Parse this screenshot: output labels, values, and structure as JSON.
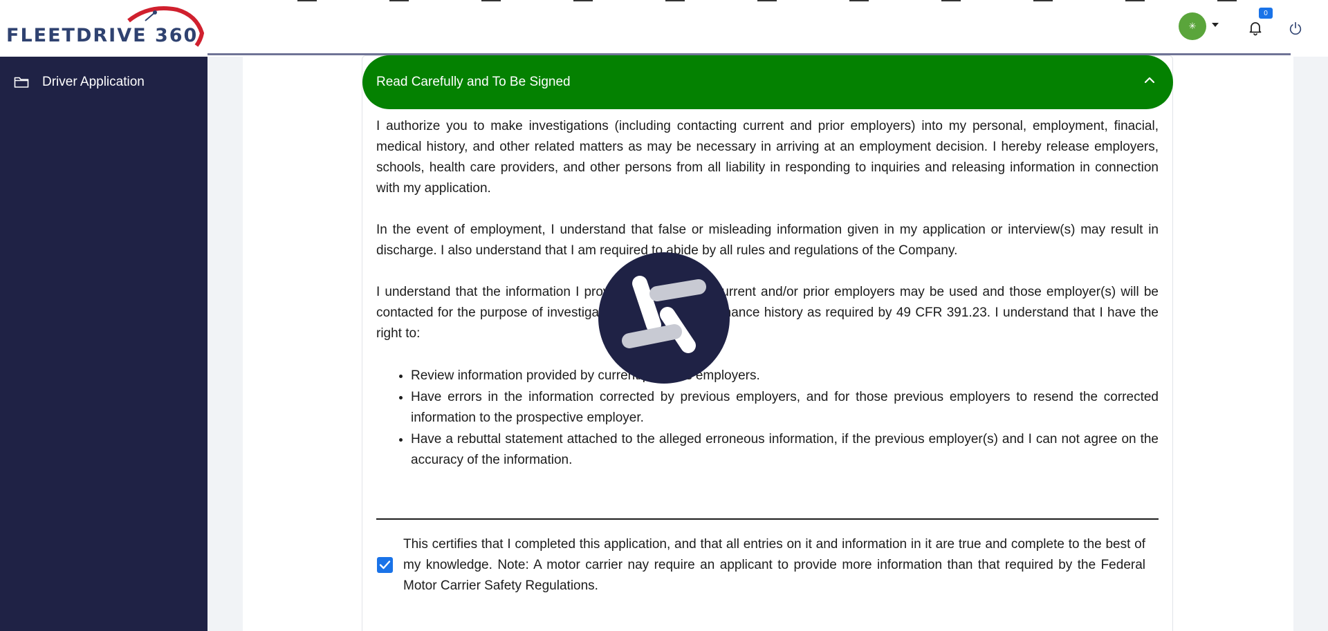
{
  "header": {
    "logo_text": "FLEETDRIVE 360",
    "notifications_count": "0",
    "avatar_glyph": "✳"
  },
  "sidebar": {
    "items": [
      {
        "label": "Driver Application",
        "icon": "folder-icon"
      }
    ]
  },
  "accordion": {
    "title": "Read Carefully and To Be Signed",
    "expanded": true
  },
  "content": {
    "paragraph1": "I authorize you to make investigations (including contacting current and prior employers) into my personal, employment, finacial, medical history, and other related matters as may be necessary in arriving at an employment decision. I hereby release employers, schools, health care providers, and other persons from all liability in responding to inquiries and releasing information in connection with my application.",
    "paragraph2": "In the event of employment, I understand that false or misleading information given in my application or interview(s) may result in discharge. I also understand that I am required to abide by all rules and regulations of the Company.",
    "paragraph3": "I understand that the information I provide regarding my current and/or prior employers may be used and those employer(s) will be contacted for the purpose of investigating my safety performance history as required by 49 CFR 391.23. I understand that I have the right to:",
    "rights": [
      "Review information provided by current/previous employers.",
      "Have errors in the information corrected by previous employers, and for those previous employers to resend the corrected information to the prospective employer.",
      "Have a rebuttal statement attached to the alleged erroneous information, if the previous employer(s) and I can not agree on the accuracy of the information."
    ]
  },
  "certification": {
    "checked": true,
    "text": "This certifies that I completed this application, and that all entries on it and information in it are true and complete to the best of my knowledge. Note: A motor carrier nay require an applicant to provide more information than that required by the Federal Motor Carrier Safety Regulations."
  },
  "colors": {
    "sidebar_bg": "#1f2245",
    "accordion_header": "#048101",
    "checkbox": "#1a73e8",
    "brand_red": "#d0202e",
    "brand_navy": "#2f4270"
  }
}
